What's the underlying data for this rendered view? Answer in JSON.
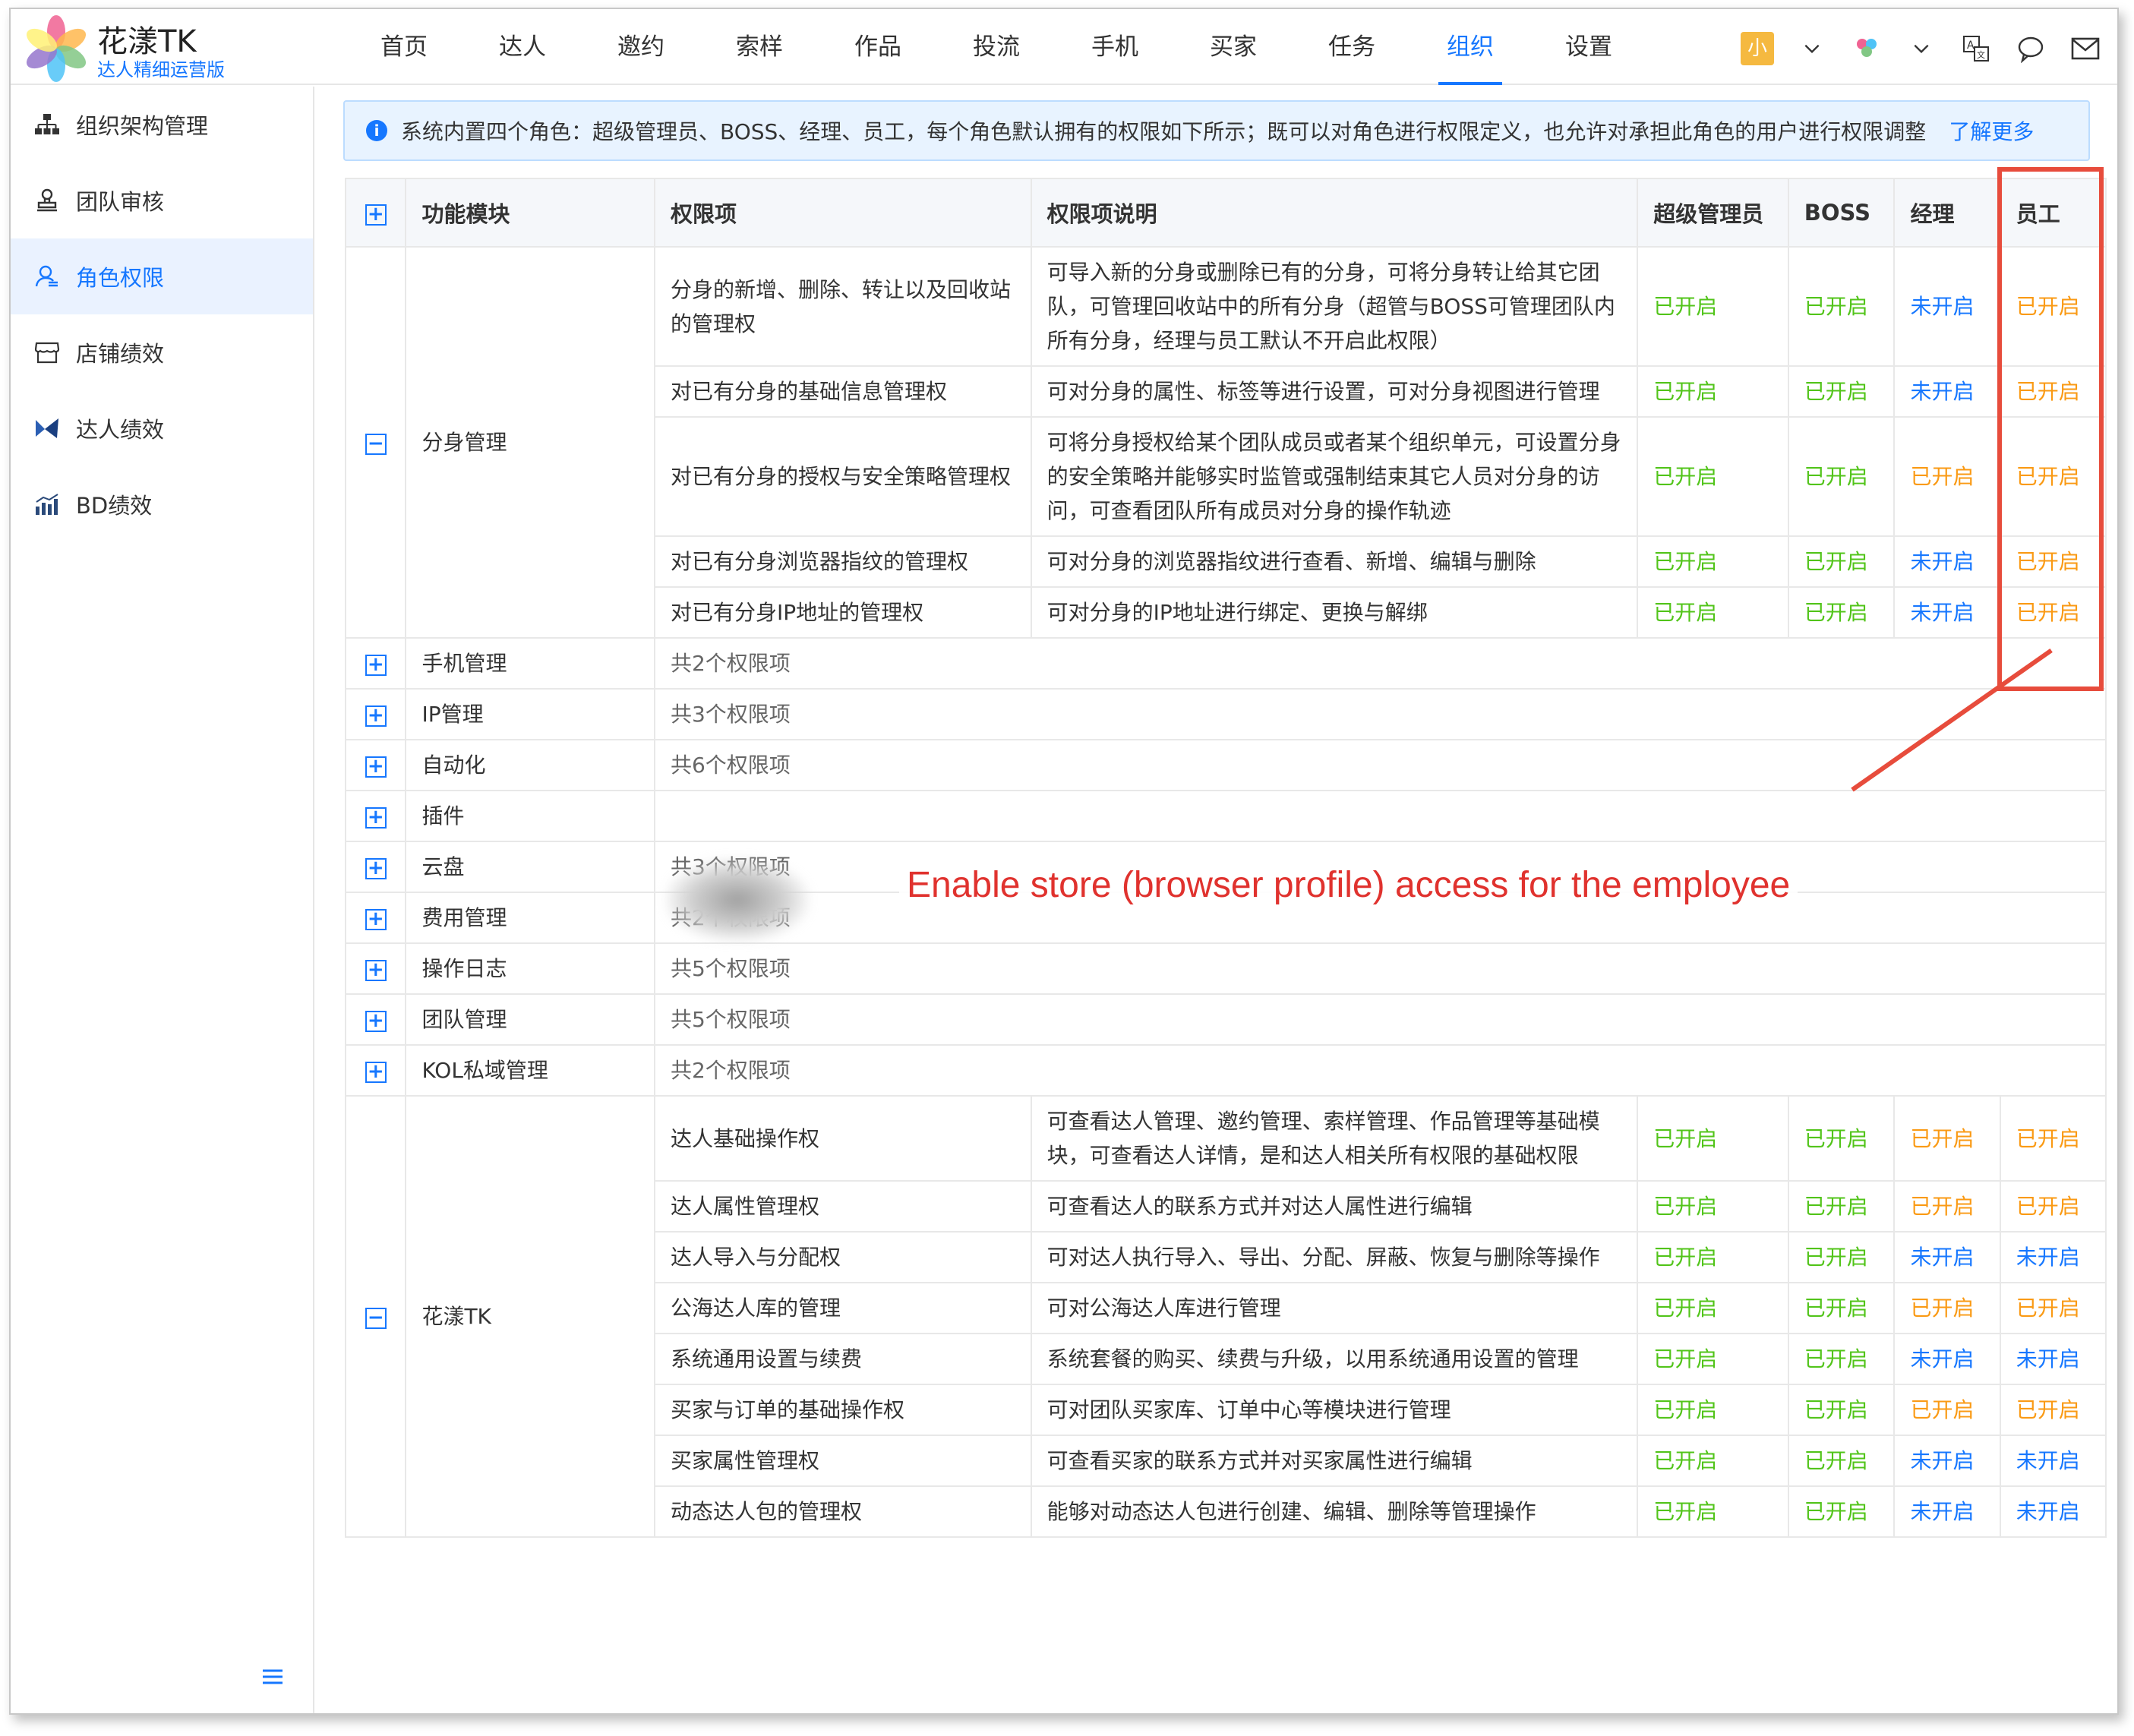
{
  "app": {
    "name": "花漾TK",
    "subtitle": "达人精细运营版"
  },
  "nav": [
    "首页",
    "达人",
    "邀约",
    "索样",
    "作品",
    "投流",
    "手机",
    "买家",
    "任务",
    "组织",
    "设置"
  ],
  "nav_active": "组织",
  "user": {
    "avatar_text": "小"
  },
  "sidebar": [
    {
      "label": "组织架构管理",
      "icon": "org-chart-icon"
    },
    {
      "label": "团队审核",
      "icon": "stamp-icon"
    },
    {
      "label": "角色权限",
      "icon": "user-role-icon",
      "active": true
    },
    {
      "label": "店铺绩效",
      "icon": "shop-icon"
    },
    {
      "label": "达人绩效",
      "icon": "kol-icon"
    },
    {
      "label": "BD绩效",
      "icon": "bar-chart-icon"
    }
  ],
  "notice": {
    "text": "系统内置四个角色：超级管理员、BOSS、经理、员工，每个角色默认拥有的权限如下所示；既可以对角色进行权限定义，也允许对承担此角色的用户进行权限调整",
    "link": "了解更多"
  },
  "table": {
    "headers": [
      "功能模块",
      "权限项",
      "权限项说明",
      "超级管理员",
      "BOSS",
      "经理",
      "员工"
    ],
    "groups": [
      {
        "module": "分身管理",
        "expanded": true,
        "items": [
          {
            "name": "分身的新增、删除、转让以及回收站的管理权",
            "desc": "可导入新的分身或删除已有的分身，可将分身转让给其它团队，可管理回收站中的所有分身（超管与BOSS可管理团队内所有分身，经理与员工默认不开启此权限）",
            "roles": [
              "已开启",
              "已开启",
              "未开启",
              "已开启"
            ]
          },
          {
            "name": "对已有分身的基础信息管理权",
            "desc": "可对分身的属性、标签等进行设置，可对分身视图进行管理",
            "roles": [
              "已开启",
              "已开启",
              "未开启",
              "已开启"
            ]
          },
          {
            "name": "对已有分身的授权与安全策略管理权",
            "desc": "可将分身授权给某个团队成员或者某个组织单元，可设置分身的安全策略并能够实时监管或强制结束其它人员对分身的访问，可查看团队所有成员对分身的操作轨迹",
            "roles": [
              "已开启",
              "已开启",
              "已开启",
              "已开启"
            ]
          },
          {
            "name": "对已有分身浏览器指纹的管理权",
            "desc": "可对分身的浏览器指纹进行查看、新增、编辑与删除",
            "roles": [
              "已开启",
              "已开启",
              "未开启",
              "已开启"
            ]
          },
          {
            "name": "对已有分身IP地址的管理权",
            "desc": "可对分身的IP地址进行绑定、更换与解绑",
            "roles": [
              "已开启",
              "已开启",
              "未开启",
              "已开启"
            ]
          }
        ]
      },
      {
        "module": "手机管理",
        "summary": "共2个权限项"
      },
      {
        "module": "IP管理",
        "summary": "共3个权限项"
      },
      {
        "module": "自动化",
        "summary": "共6个权限项"
      },
      {
        "module": "插件",
        "summary": ""
      },
      {
        "module": "云盘",
        "summary": "共3个权限项"
      },
      {
        "module": "费用管理",
        "summary": "共2个权限项"
      },
      {
        "module": "操作日志",
        "summary": "共5个权限项"
      },
      {
        "module": "团队管理",
        "summary": "共5个权限项"
      },
      {
        "module": "KOL私域管理",
        "summary": "共2个权限项"
      },
      {
        "module": "花漾TK",
        "expanded": true,
        "items": [
          {
            "name": "达人基础操作权",
            "desc": "可查看达人管理、邀约管理、索样管理、作品管理等基础模块，可查看达人详情，是和达人相关所有权限的基础权限",
            "roles": [
              "已开启",
              "已开启",
              "已开启",
              "已开启"
            ]
          },
          {
            "name": "达人属性管理权",
            "desc": "可查看达人的联系方式并对达人属性进行编辑",
            "roles": [
              "已开启",
              "已开启",
              "已开启",
              "已开启"
            ]
          },
          {
            "name": "达人导入与分配权",
            "desc": "可对达人执行导入、导出、分配、屏蔽、恢复与删除等操作",
            "roles": [
              "已开启",
              "已开启",
              "未开启",
              "未开启"
            ]
          },
          {
            "name": "公海达人库的管理",
            "desc": "可对公海达人库进行管理",
            "roles": [
              "已开启",
              "已开启",
              "已开启",
              "已开启"
            ]
          },
          {
            "name": "系统通用设置与续费",
            "desc": "系统套餐的购买、续费与升级，以用系统通用设置的管理",
            "roles": [
              "已开启",
              "已开启",
              "未开启",
              "未开启"
            ]
          },
          {
            "name": "买家与订单的基础操作权",
            "desc": "可对团队买家库、订单中心等模块进行管理",
            "roles": [
              "已开启",
              "已开启",
              "已开启",
              "已开启"
            ]
          },
          {
            "name": "买家属性管理权",
            "desc": "可查看买家的联系方式并对买家属性进行编辑",
            "roles": [
              "已开启",
              "已开启",
              "未开启",
              "未开启"
            ]
          },
          {
            "name": "动态达人包的管理权",
            "desc": "能够对动态达人包进行创建、编辑、删除等管理操作",
            "roles": [
              "已开启",
              "已开启",
              "未开启",
              "未开启"
            ]
          }
        ]
      }
    ]
  },
  "annotation": "Enable store (browser profile) access for the employee",
  "colors": {
    "accent": "#1677ff",
    "enabled": "#52c41a",
    "enabled_orange": "#fa9a14",
    "disabled": "#1677ff",
    "highlight": "#e74c3c"
  }
}
